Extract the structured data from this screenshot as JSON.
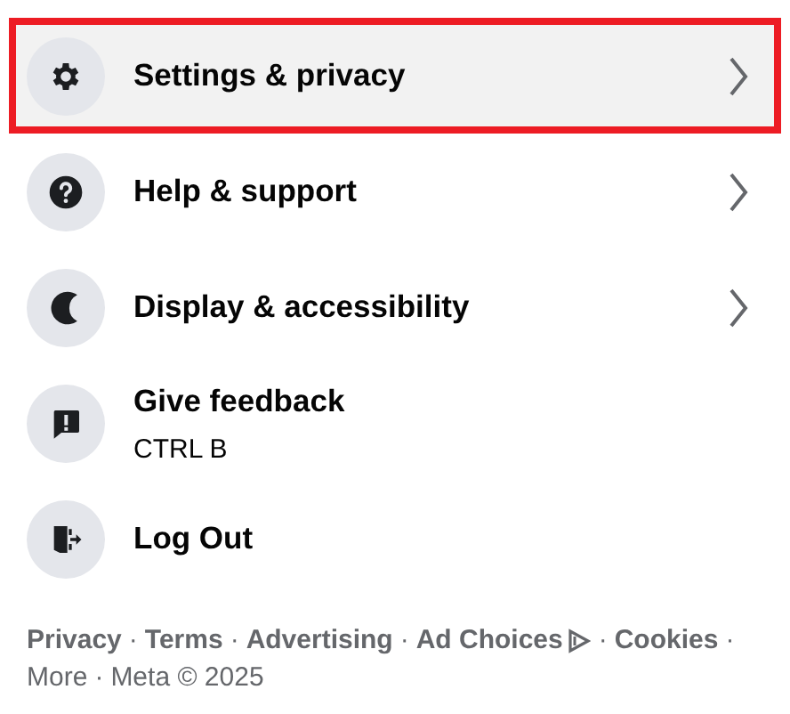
{
  "menu": [
    {
      "kind": "gear",
      "label": "Settings & privacy",
      "submenu": true,
      "highlighted": true
    },
    {
      "kind": "help",
      "label": "Help & support",
      "submenu": true,
      "highlighted": false
    },
    {
      "kind": "moon",
      "label": "Display & accessibility",
      "submenu": true,
      "highlighted": false
    },
    {
      "kind": "feedback",
      "label": "Give feedback",
      "shortcut": "CTRL B",
      "submenu": false,
      "highlighted": false
    },
    {
      "kind": "logout",
      "label": "Log Out",
      "submenu": false,
      "highlighted": false
    }
  ],
  "footer": {
    "separator": "·",
    "lines": [
      [
        {
          "label": "Privacy"
        },
        {
          "label": "Terms"
        },
        {
          "label": "Advertising"
        },
        {
          "label": "Ad Choices",
          "ad_icon": true
        },
        {
          "label": "Cookies"
        }
      ],
      [
        {
          "label": "More"
        },
        {
          "label": "Meta © 2025"
        }
      ]
    ]
  }
}
